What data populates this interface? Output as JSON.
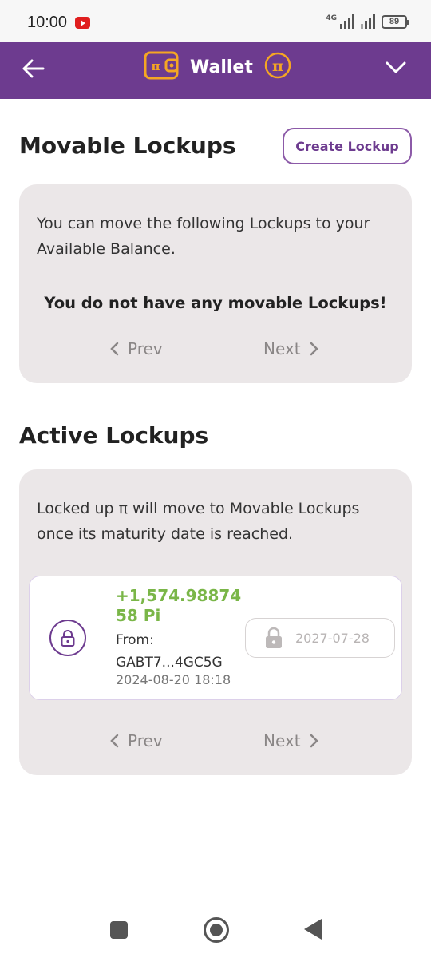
{
  "status_bar": {
    "time": "10:00",
    "network": "4G",
    "battery": "89"
  },
  "header": {
    "title": "Wallet",
    "pi_symbol": "π"
  },
  "movable": {
    "title": "Movable Lockups",
    "create_button": "Create Lockup",
    "description": "You can move the following Lockups to your Available Balance.",
    "empty_message": "You do not have any movable Lockups!",
    "prev_label": "Prev",
    "next_label": "Next"
  },
  "active": {
    "title": "Active Lockups",
    "description": "Locked up π will move to Movable Lockups once its maturity date is reached.",
    "lockups": [
      {
        "amount": "+1,574.9887458 Pi",
        "from_label": "From:",
        "from_address": "GABT7...4GC5G",
        "created": "2024-08-20 18:18",
        "unlock_date": "2027-07-28"
      }
    ],
    "prev_label": "Prev",
    "next_label": "Next"
  },
  "colors": {
    "brand_purple": "#6d3b8f",
    "pi_orange": "#f5a623",
    "amount_green": "#7ab648",
    "card_bg": "#ebe7e8"
  }
}
